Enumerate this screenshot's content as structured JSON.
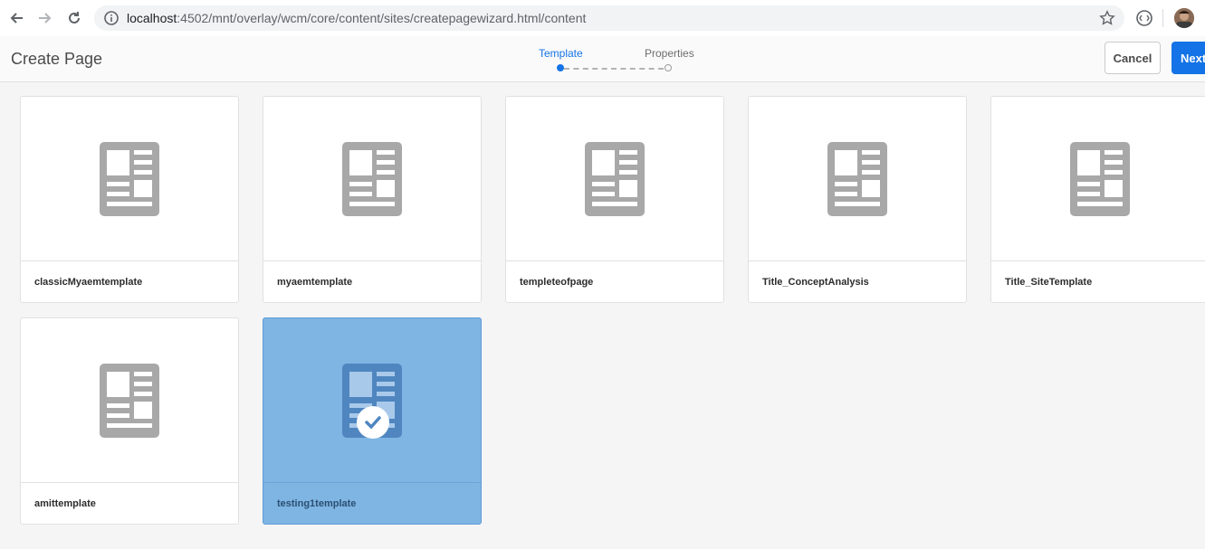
{
  "browser": {
    "url_host": "localhost",
    "url_path": ":4502/mnt/overlay/wcm/core/content/sites/createpagewizard.html/content"
  },
  "header": {
    "title": "Create Page",
    "steps": [
      {
        "label": "Template",
        "state": "active"
      },
      {
        "label": "Properties",
        "state": "pending"
      }
    ],
    "cancel_label": "Cancel",
    "next_label": "Next"
  },
  "templates": [
    {
      "name": "classicMyaemtemplate",
      "selected": false
    },
    {
      "name": "myaemtemplate",
      "selected": false
    },
    {
      "name": "templeteofpage",
      "selected": false
    },
    {
      "name": "Title_ConceptAnalysis",
      "selected": false
    },
    {
      "name": "Title_SiteTemplate",
      "selected": false
    },
    {
      "name": "amittemplate",
      "selected": false
    },
    {
      "name": "testing1template",
      "selected": true
    }
  ],
  "colors": {
    "accent": "#1473e6",
    "selected_card": "#7fb5e3",
    "template_icon": "#a8a8a8",
    "template_icon_selected": "#4f86c0"
  },
  "icons": {
    "back": "arrow-left-icon",
    "forward": "arrow-right-icon",
    "reload": "reload-icon",
    "info": "info-icon",
    "bookmark": "star-icon",
    "extension": "extension-icon",
    "template": "page-template-icon",
    "selected": "checkmark-icon"
  }
}
